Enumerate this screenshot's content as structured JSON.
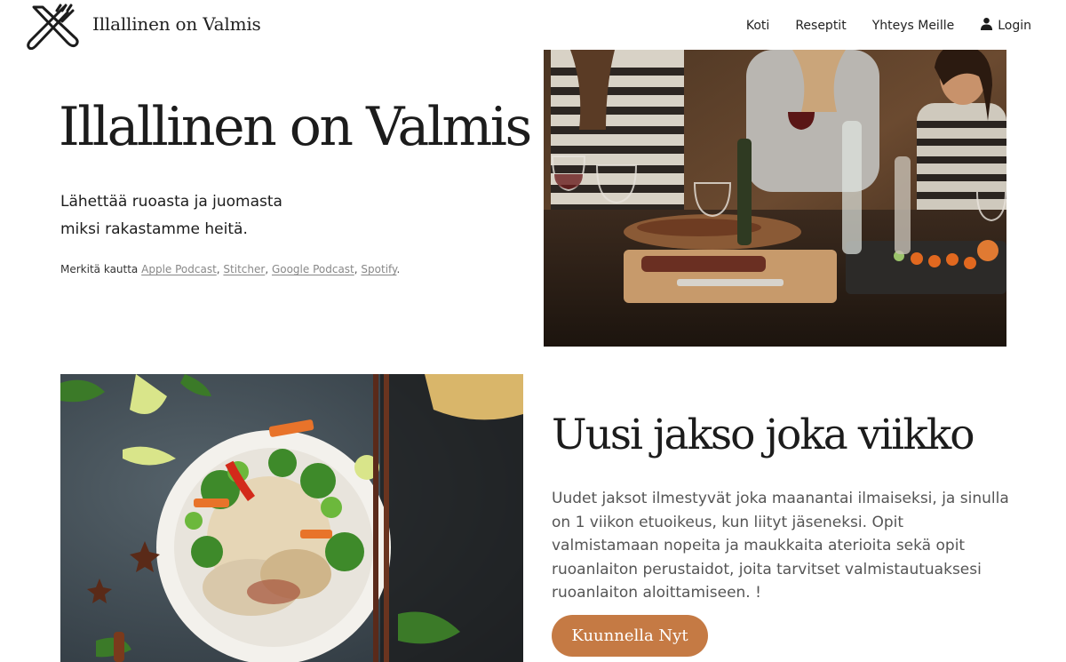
{
  "header": {
    "brand": "Illallinen on Valmis",
    "logo_icon": "fork-knife-crossed-icon",
    "nav": [
      {
        "label": "Koti"
      },
      {
        "label": "Reseptit"
      },
      {
        "label": "Yhteys Meille"
      },
      {
        "label": "Login",
        "icon": "user-icon"
      }
    ]
  },
  "hero": {
    "title": "Illallinen on Valmis",
    "subtitle_line1": "Lähettää ruoasta ja juomasta",
    "subtitle_line2": "miksi rakastamme heitä.",
    "subscribe_prefix": "Merkitä kautta",
    "platforms": [
      "Apple Podcast",
      "Stitcher",
      "Google Podcast",
      "Spotify"
    ]
  },
  "section": {
    "title": "Uusi jakso joka viikko",
    "text": "Uudet jaksot ilmestyvät joka maanantai ilmaiseksi, ja sinulla on 1 viikon etuoikeus, kun liityt jäseneksi. Opit valmistamaan nopeita ja maukkaita aterioita sekä opit ruoanlaiton perustaidot, joita tarvitset valmistautuaksesi ruoanlaiton aloittamiseen. !",
    "button_label": "Kuunnella Nyt"
  },
  "colors": {
    "accent": "#c57a44",
    "text": "#1c1c1c",
    "link": "#888888"
  }
}
